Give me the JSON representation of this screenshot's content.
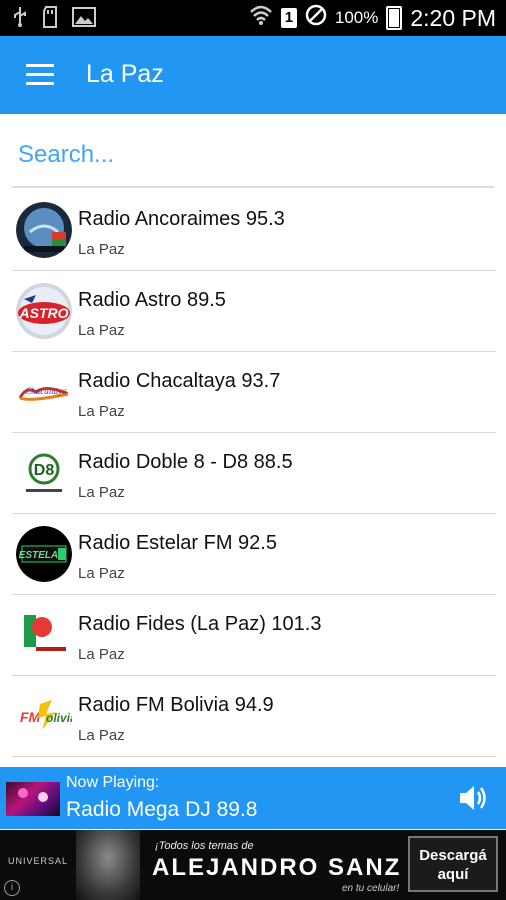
{
  "statusbar": {
    "left_icons": [
      "usb-icon",
      "sd-card-icon",
      "image-icon"
    ],
    "sim_number": "1",
    "battery_pct": "100%",
    "time": "2:20 PM"
  },
  "appbar": {
    "title": "La Paz"
  },
  "search": {
    "placeholder": "Search..."
  },
  "stations": [
    {
      "name": "Radio Ancoraimes 95.3",
      "city": "La Paz"
    },
    {
      "name": "Radio Astro 89.5",
      "city": "La Paz"
    },
    {
      "name": "Radio Chacaltaya 93.7",
      "city": "La Paz"
    },
    {
      "name": "Radio Doble 8 - D8 88.5",
      "city": "La Paz"
    },
    {
      "name": "Radio Estelar FM 92.5",
      "city": "La Paz"
    },
    {
      "name": "Radio Fides (La Paz) 101.3",
      "city": "La Paz"
    },
    {
      "name": "Radio FM Bolivia 94.9",
      "city": "La Paz"
    }
  ],
  "player": {
    "label": "Now Playing:",
    "title": "Radio Mega DJ 89.8"
  },
  "ad": {
    "brand": "UNIVERSAL",
    "line1": "¡Todos los temas de",
    "line2": "ALEJANDRO SANZ",
    "line3": "en tu celular!",
    "cta_line1": "Descargá",
    "cta_line2": "aquí",
    "info": "i"
  },
  "colors": {
    "primary": "#2196f3",
    "accent": "#42a5f5"
  }
}
